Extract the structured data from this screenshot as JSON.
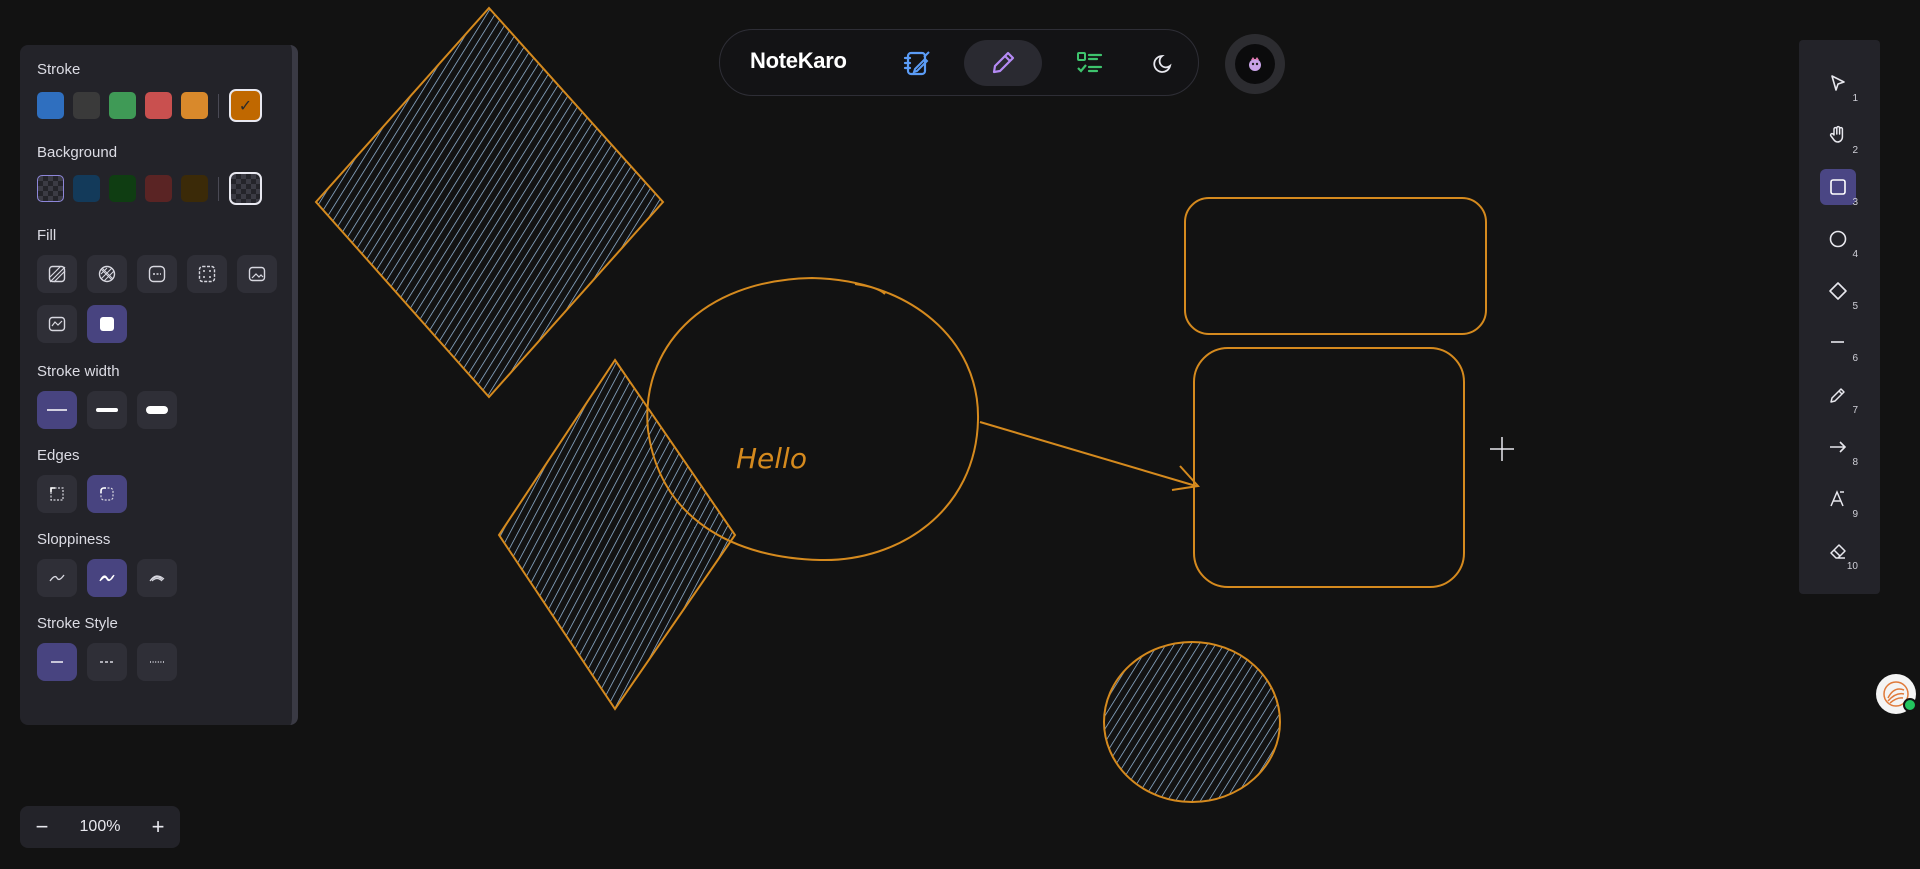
{
  "app": {
    "brand": "NoteKaro"
  },
  "properties": {
    "stroke": {
      "label": "Stroke",
      "colors": [
        "#2f6fbf",
        "#3a3a3a",
        "#3f9a56",
        "#c9504f",
        "#d9892b"
      ],
      "selected": "#c06800"
    },
    "background": {
      "label": "Background",
      "colors": [
        "transparent",
        "#133a5a",
        "#0f3d12",
        "#5a2424",
        "#3b2a08"
      ],
      "selected": "transparent"
    },
    "fill": {
      "label": "Fill",
      "options": [
        "hachure",
        "cross-hatch",
        "dashed",
        "dots",
        "image",
        "image-alt",
        "solid"
      ],
      "selected": "solid"
    },
    "stroke_width": {
      "label": "Stroke width",
      "options": [
        "thin",
        "bold",
        "extra-bold"
      ],
      "selected": "thin"
    },
    "edges": {
      "label": "Edges",
      "options": [
        "sharp",
        "round"
      ],
      "selected": "round"
    },
    "sloppiness": {
      "label": "Sloppiness",
      "options": [
        "architect",
        "artist",
        "cartoonist"
      ],
      "selected": "artist"
    },
    "stroke_style": {
      "label": "Stroke Style",
      "options": [
        "solid",
        "dashed",
        "dotted"
      ],
      "selected": "solid"
    }
  },
  "toolbar": {
    "items": [
      {
        "name": "select",
        "icon": "pointer-icon",
        "shortcut": "1"
      },
      {
        "name": "hand",
        "icon": "hand-icon",
        "shortcut": "2"
      },
      {
        "name": "rectangle",
        "icon": "square-icon",
        "shortcut": "3",
        "selected": true
      },
      {
        "name": "ellipse",
        "icon": "circle-icon",
        "shortcut": "4"
      },
      {
        "name": "diamond",
        "icon": "diamond-icon",
        "shortcut": "5"
      },
      {
        "name": "line",
        "icon": "line-icon",
        "shortcut": "6"
      },
      {
        "name": "draw",
        "icon": "pencil-icon",
        "shortcut": "7"
      },
      {
        "name": "arrow",
        "icon": "arrow-icon",
        "shortcut": "8"
      },
      {
        "name": "text",
        "icon": "text-icon",
        "shortcut": "9"
      },
      {
        "name": "eraser",
        "icon": "eraser-icon",
        "shortcut": "10"
      }
    ]
  },
  "header": {
    "buttons": [
      {
        "name": "notebook",
        "icon": "notebook-edit-icon",
        "color": "#5b9cf6"
      },
      {
        "name": "draw",
        "icon": "pencil-icon",
        "color": "#b58af5",
        "active": true
      },
      {
        "name": "tasks",
        "icon": "checklist-icon",
        "color": "#3ec46d"
      },
      {
        "name": "theme",
        "icon": "moon-icon",
        "color": "#e8e8ee"
      }
    ]
  },
  "canvas": {
    "text_element": "Hello",
    "stroke_color": "#d58a1e",
    "hachure_color": "#9fc4e6"
  },
  "zoom": {
    "value": "100%",
    "minus": "−",
    "plus": "+"
  }
}
